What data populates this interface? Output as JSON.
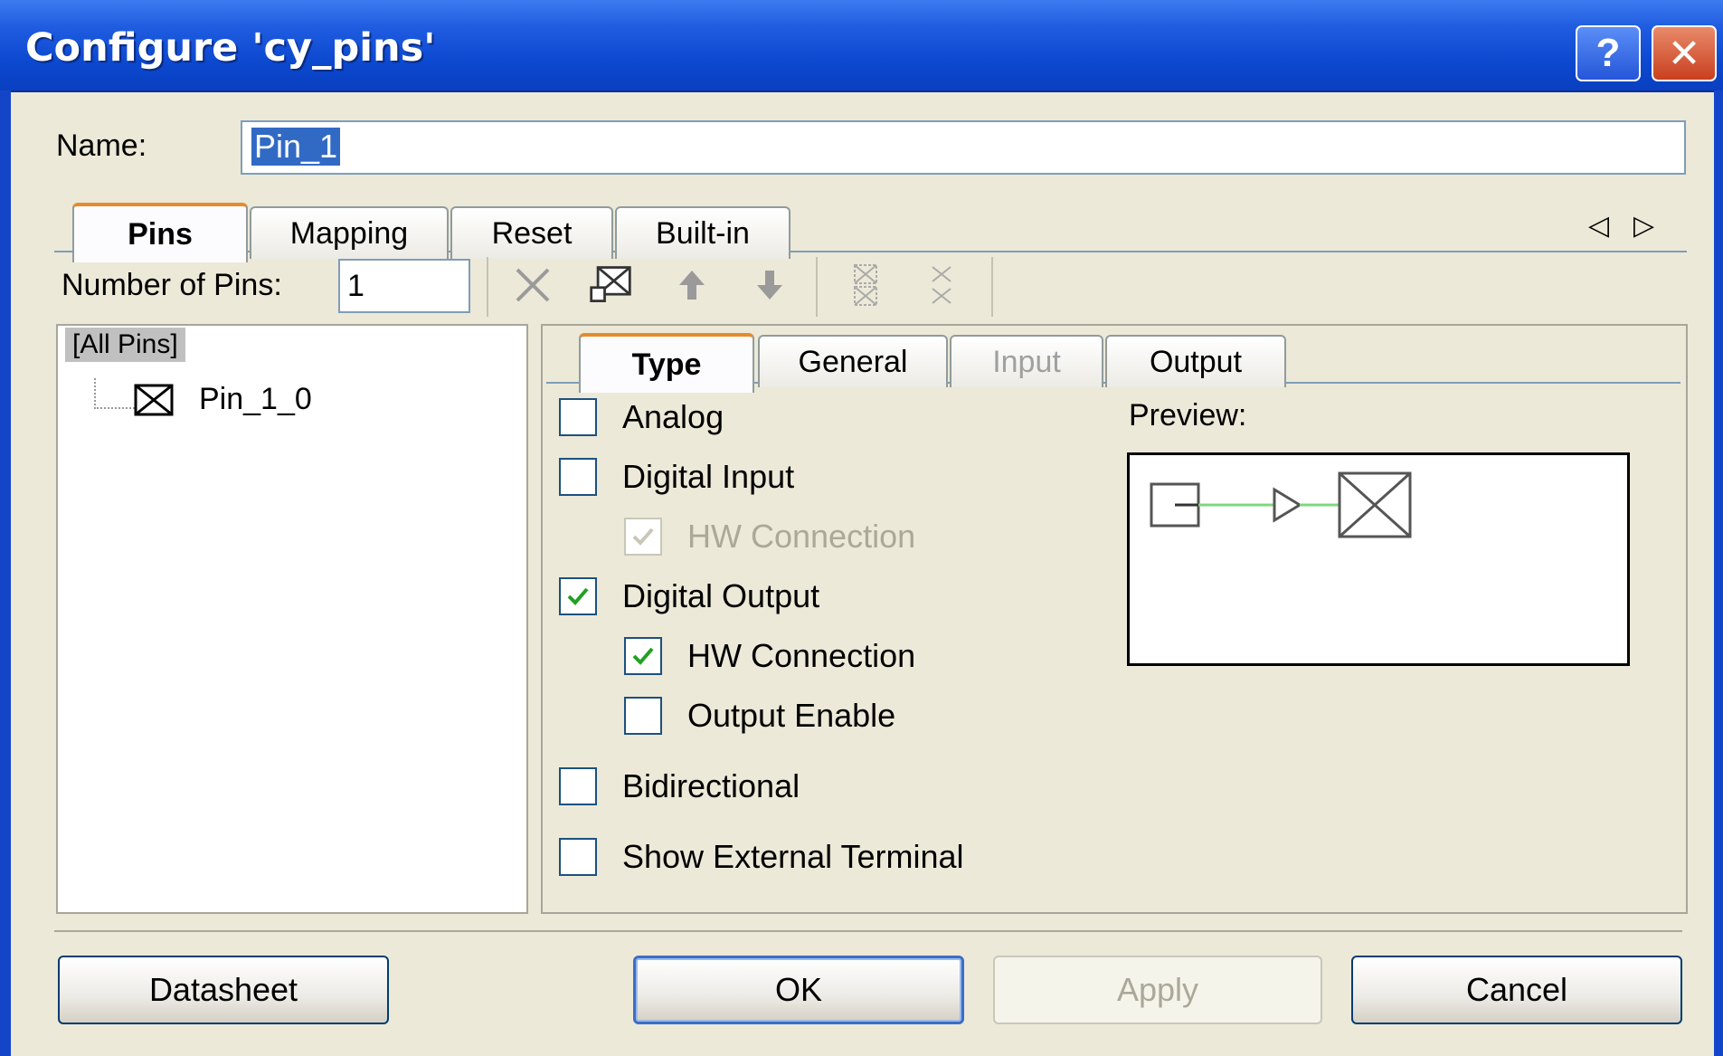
{
  "window": {
    "title": "Configure 'cy_pins'",
    "help_glyph": "?",
    "close_glyph": "✕"
  },
  "name_field": {
    "label": "Name:",
    "value": "Pin_1"
  },
  "top_tabs": [
    {
      "label": "Pins",
      "state": "active"
    },
    {
      "label": "Mapping",
      "state": "normal"
    },
    {
      "label": "Reset",
      "state": "normal"
    },
    {
      "label": "Built-in",
      "state": "normal"
    }
  ],
  "tab_scroll": {
    "left_glyph": "◁",
    "right_glyph": "▷"
  },
  "pins_toolbar": {
    "count_label": "Number of Pins:",
    "count_value": "1",
    "tools": [
      "delete-icon",
      "add-pin-icon",
      "move-up-icon",
      "move-down-icon",
      "ungroup-icon",
      "group-icon"
    ]
  },
  "tree": {
    "root": "[All Pins]",
    "items": [
      "Pin_1_0"
    ]
  },
  "inner_tabs": [
    {
      "label": "Type",
      "state": "active"
    },
    {
      "label": "General",
      "state": "normal"
    },
    {
      "label": "Input",
      "state": "disabled"
    },
    {
      "label": "Output",
      "state": "normal"
    }
  ],
  "type_options": [
    {
      "label": "Analog",
      "checked": false,
      "enabled": true,
      "indent": false
    },
    {
      "label": "Digital Input",
      "checked": false,
      "enabled": true,
      "indent": false
    },
    {
      "label": "HW Connection",
      "checked": true,
      "enabled": false,
      "indent": true
    },
    {
      "label": "Digital Output",
      "checked": true,
      "enabled": true,
      "indent": false
    },
    {
      "label": "HW Connection",
      "checked": true,
      "enabled": true,
      "indent": true
    },
    {
      "label": "Output Enable",
      "checked": false,
      "enabled": true,
      "indent": true
    },
    {
      "label": "Bidirectional",
      "checked": false,
      "enabled": true,
      "indent": false
    },
    {
      "label": "Show External Terminal",
      "checked": false,
      "enabled": true,
      "indent": false
    }
  ],
  "preview": {
    "label": "Preview:"
  },
  "buttons": {
    "datasheet": "Datasheet",
    "ok": "OK",
    "apply": "Apply",
    "cancel": "Cancel"
  },
  "colors": {
    "title_bar": "#0b48cf",
    "check_green": "#21a121",
    "wire_green": "#7dd87d",
    "tab_highlight": "#e68b2c",
    "selection": "#316ac5"
  }
}
